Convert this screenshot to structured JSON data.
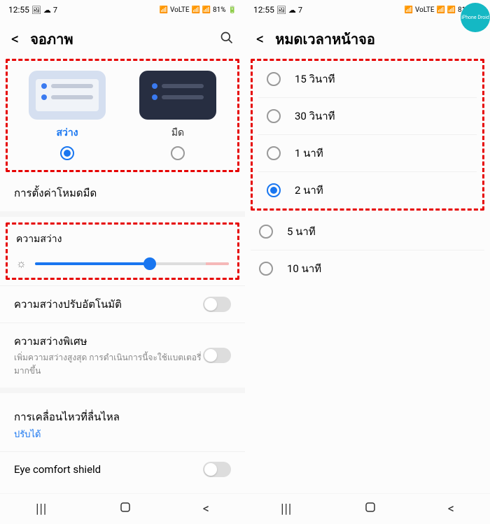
{
  "status": {
    "time": "12:55",
    "network": "VoLTE",
    "battery": "81%"
  },
  "left": {
    "title": "จอภาพ",
    "theme": {
      "light_label": "สว่าง",
      "dark_label": "มืด",
      "selected": "light"
    },
    "dark_mode_settings": "การตั้งค่าโหมดมืด",
    "brightness": {
      "label": "ความสว่าง",
      "value": 58
    },
    "auto_brightness": "ความสว่างปรับอัตโนมัติ",
    "extra_brightness": {
      "title": "ความสว่างพิเศษ",
      "sub": "เพิ่มความสว่างสูงสุด การดำเนินการนี้จะใช้แบตเตอรี่มากขึ้น"
    },
    "motion": {
      "title": "การเคลื่อนไหวที่ลื่นไหล",
      "link": "ปรับได้"
    },
    "eye_comfort": "Eye comfort shield"
  },
  "right": {
    "title": "หมดเวลาหน้าจอ",
    "options": [
      {
        "label": "15 วินาที",
        "selected": false
      },
      {
        "label": "30 วินาที",
        "selected": false
      },
      {
        "label": "1 นาที",
        "selected": false
      },
      {
        "label": "2 นาที",
        "selected": true
      },
      {
        "label": "5 นาที",
        "selected": false
      },
      {
        "label": "10 นาที",
        "selected": false
      }
    ]
  },
  "badge": "iPhone Droid"
}
